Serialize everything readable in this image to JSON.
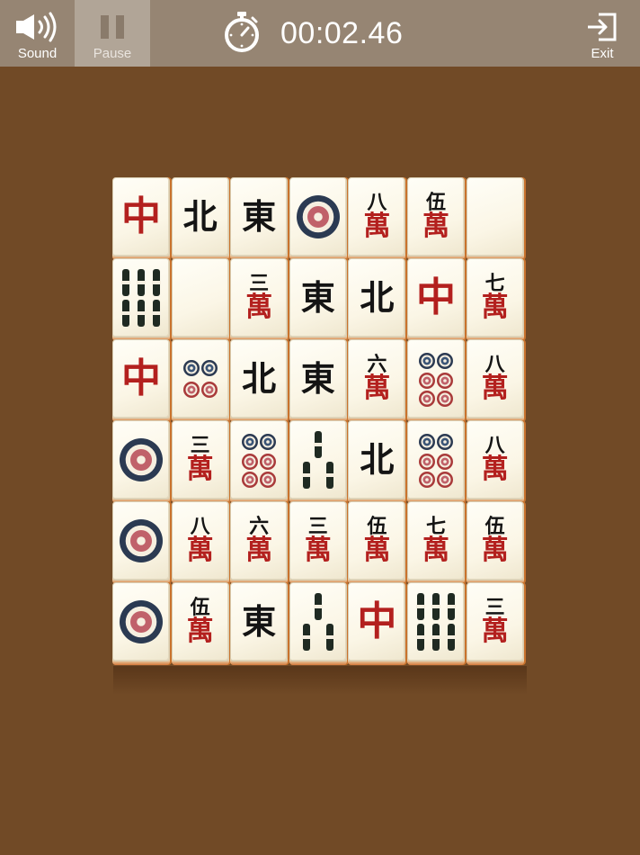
{
  "toolbar": {
    "sound_label": "Sound",
    "pause_label": "Pause",
    "exit_label": "Exit",
    "timer": "00:02.46",
    "sound_icon": "speaker-icon",
    "pause_icon": "pause-icon",
    "timer_icon": "stopwatch-icon",
    "exit_icon": "exit-icon"
  },
  "colors": {
    "background": "#714a26",
    "toolbar": "#968573",
    "pause_active": "#b1a597",
    "red_glyph": "#b3201e",
    "black_glyph": "#141414"
  },
  "board": {
    "rows": [
      [
        {
          "kind": "red",
          "text": "中"
        },
        {
          "kind": "black",
          "text": "北"
        },
        {
          "kind": "black",
          "text": "東"
        },
        {
          "kind": "dots",
          "count": 1
        },
        {
          "kind": "wan",
          "num": "八",
          "text": "萬"
        },
        {
          "kind": "wan",
          "num": "伍",
          "text": "萬"
        },
        {
          "kind": "blank"
        }
      ],
      [
        {
          "kind": "bamboo",
          "count": 6
        },
        {
          "kind": "blank"
        },
        {
          "kind": "wan",
          "num": "三",
          "text": "萬"
        },
        {
          "kind": "black",
          "text": "東"
        },
        {
          "kind": "black",
          "text": "北"
        },
        {
          "kind": "red",
          "text": "中"
        },
        {
          "kind": "wan",
          "num": "七",
          "text": "萬"
        }
      ],
      [
        {
          "kind": "red",
          "text": "中"
        },
        {
          "kind": "dots",
          "count": 4
        },
        {
          "kind": "black",
          "text": "北"
        },
        {
          "kind": "black",
          "text": "東"
        },
        {
          "kind": "wan",
          "num": "六",
          "text": "萬"
        },
        {
          "kind": "dots",
          "count": 6
        },
        {
          "kind": "wan",
          "num": "八",
          "text": "萬"
        }
      ],
      [
        {
          "kind": "dots",
          "count": 1
        },
        {
          "kind": "wan",
          "num": "三",
          "text": "萬"
        },
        {
          "kind": "dots",
          "count": 6
        },
        {
          "kind": "bamboo",
          "count": 3
        },
        {
          "kind": "black",
          "text": "北"
        },
        {
          "kind": "dots",
          "count": 6
        },
        {
          "kind": "wan",
          "num": "八",
          "text": "萬"
        }
      ],
      [
        {
          "kind": "dots",
          "count": 1
        },
        {
          "kind": "wan",
          "num": "八",
          "text": "萬"
        },
        {
          "kind": "wan",
          "num": "六",
          "text": "萬"
        },
        {
          "kind": "wan",
          "num": "三",
          "text": "萬"
        },
        {
          "kind": "wan",
          "num": "伍",
          "text": "萬"
        },
        {
          "kind": "wan",
          "num": "七",
          "text": "萬"
        },
        {
          "kind": "wan",
          "num": "伍",
          "text": "萬"
        }
      ],
      [
        {
          "kind": "dots",
          "count": 1
        },
        {
          "kind": "wan",
          "num": "伍",
          "text": "萬"
        },
        {
          "kind": "black",
          "text": "東"
        },
        {
          "kind": "bamboo",
          "count": 3
        },
        {
          "kind": "red",
          "text": "中"
        },
        {
          "kind": "bamboo",
          "count": 6
        },
        {
          "kind": "wan",
          "num": "三",
          "text": "萬"
        }
      ]
    ]
  }
}
